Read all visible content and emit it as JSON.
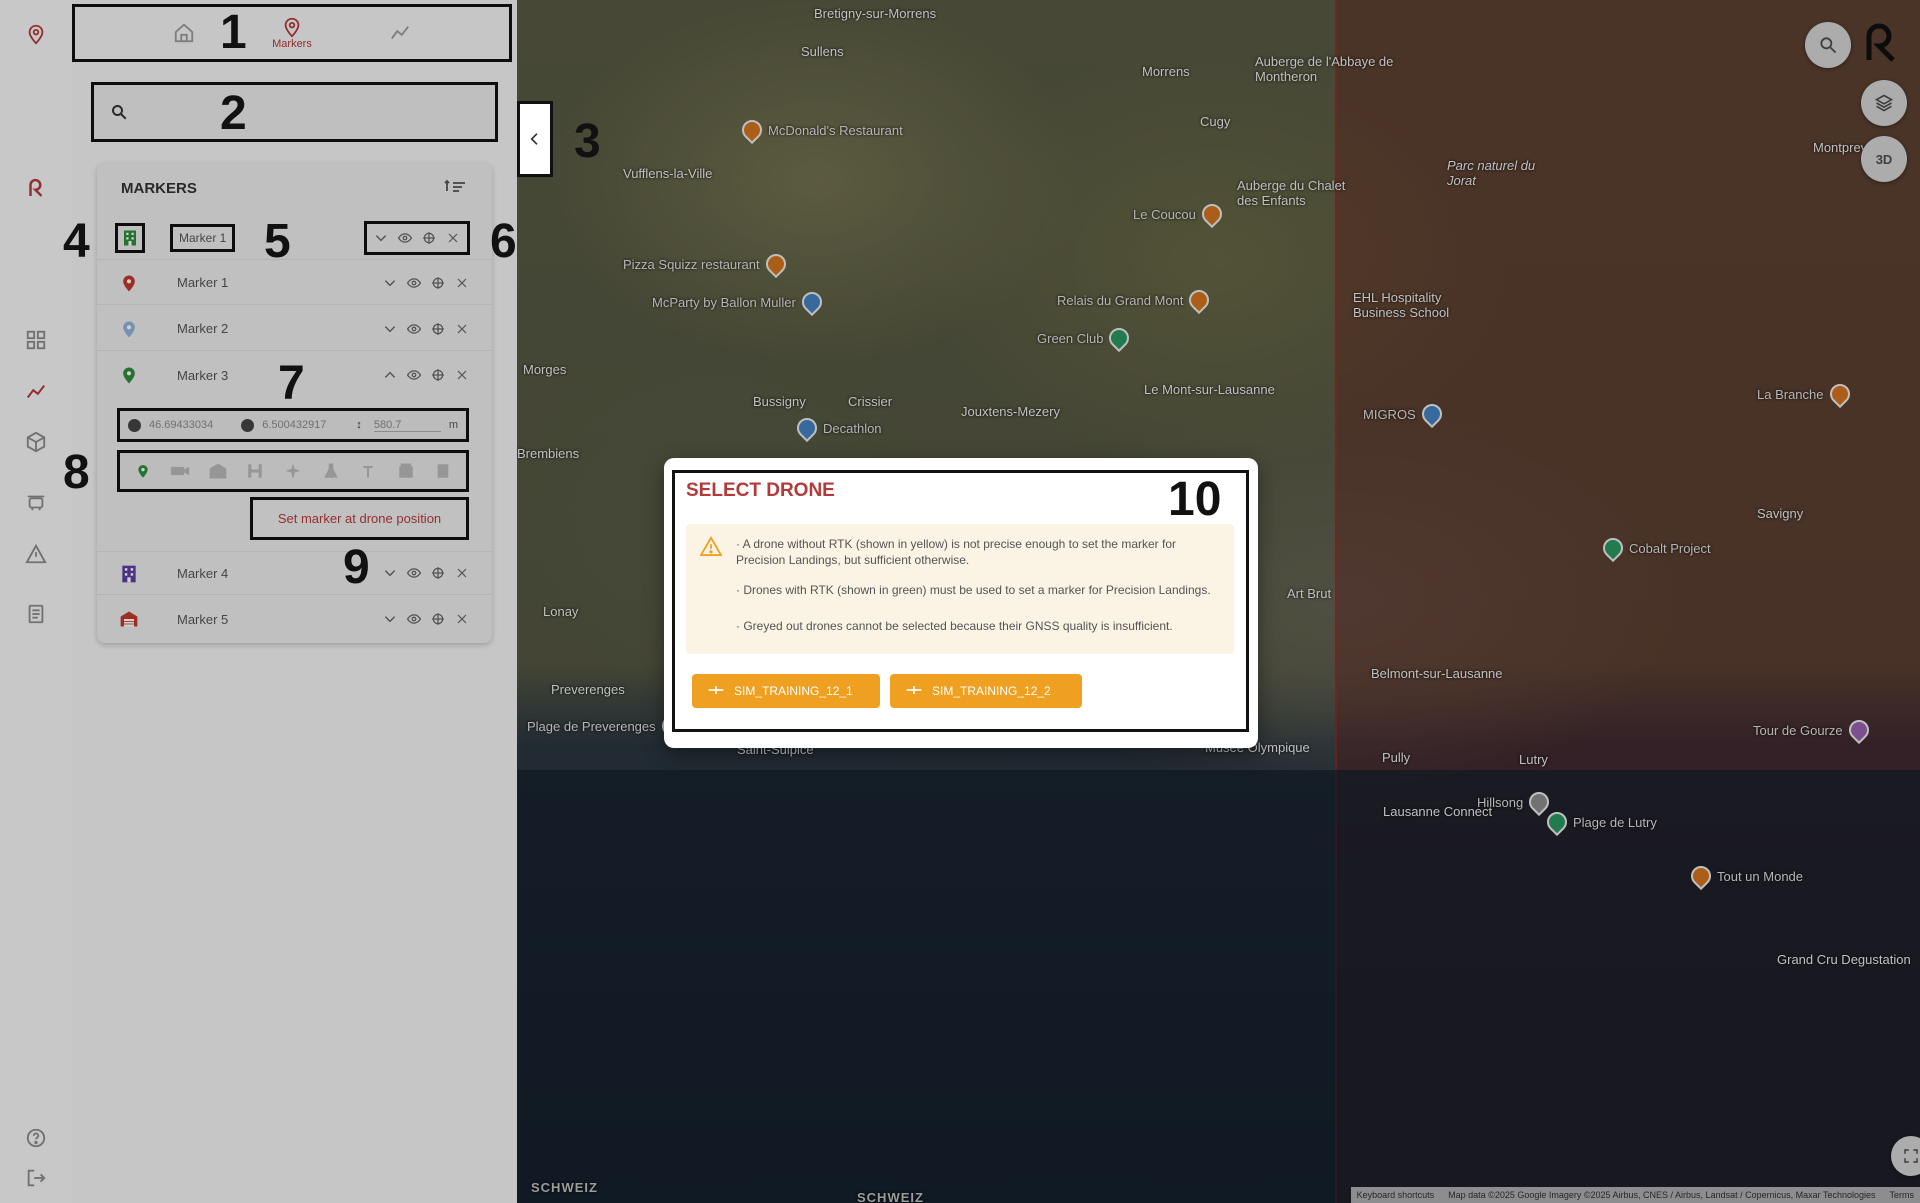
{
  "nav": {
    "home_label": "",
    "markers_label": "Markers",
    "analytics_label": ""
  },
  "search": {
    "placeholder": "",
    "value": ""
  },
  "markers": {
    "title": "MARKERS",
    "rows": [
      {
        "name": "Marker 1",
        "icon": "building-icon",
        "color": "#2e8b3e"
      },
      {
        "name": "Marker 1",
        "icon": "map-pin-icon",
        "color": "#c0392b"
      },
      {
        "name": "Marker 2",
        "icon": "map-pin-icon",
        "color": "#8fb3d9"
      },
      {
        "name": "Marker 3",
        "icon": "map-pin-icon",
        "color": "#2e8b3e"
      },
      {
        "name": "Marker 4",
        "icon": "building-icon",
        "color": "#5b3fa0"
      },
      {
        "name": "Marker 5",
        "icon": "garage-icon",
        "color": "#c0392b"
      }
    ],
    "expanded": {
      "lat": "46.69433034",
      "lon": "6.500432917",
      "alt": "580.7",
      "alt_unit": "m",
      "set_button": "Set marker at drone position"
    }
  },
  "callouts": [
    "1",
    "2",
    "3",
    "4",
    "5",
    "6",
    "7",
    "8",
    "9",
    "10"
  ],
  "dialog": {
    "title": "SELECT DRONE",
    "line1": "· A drone without RTK (shown in yellow) is not precise enough to set the marker for Precision Landings, but sufficient otherwise.",
    "line2": "· Drones with RTK (shown in green) must be used to set a marker for Precision Landings.",
    "line3": "· Greyed out drones cannot be selected because their GNSS quality is insufficient.",
    "drones": [
      "SIM_TRAINING_12_1",
      "SIM_TRAINING_12_2"
    ]
  },
  "map": {
    "places": [
      "Bretigny-sur-Morrens",
      "Sullens",
      "Morrens",
      "Cugy",
      "Vufflens-la-Ville",
      "McDonald's Restaurant",
      "Pizza Squizz restaurant",
      "McParty by Ballon Muller",
      "Le Coucou",
      "Relais du Grand Mont",
      "Green Club",
      "Morges",
      "Bussigny",
      "Crissier",
      "Decathlon",
      "Jouxtens-Mezery",
      "Le Mont-sur-Lausanne",
      "Brembiens",
      "Lonay",
      "Preverenges",
      "Plage de Preverenges",
      "Saint-Sulpice",
      "Musee Olympique",
      "Pully",
      "Lutry",
      "Hillsong",
      "Lausanne Connect",
      "Plage de Lutry",
      "Tout un Monde",
      "Tour de Gourze",
      "Savigny",
      "La Branche",
      "Montpreveyres",
      "MIGROS",
      "EHL Hospitality Business School",
      "Cobalt Project",
      "Auberge de l'Abbaye de Montheron",
      "Auberge du Chalet des Enfants",
      "Parc naturel du Jorat",
      "Belmont-sur-Lausanne",
      "Grand Cru Degustation",
      "Art Brut"
    ],
    "country_label": "SCHWEIZ",
    "btn_3d": "3D",
    "attribution_shortcuts": "Keyboard shortcuts",
    "attribution_data": "Map data ©2025 Google Imagery ©2025 Airbus, CNES / Airbus, Landsat / Copernicus, Maxar Technologies",
    "attribution_terms": "Terms"
  }
}
